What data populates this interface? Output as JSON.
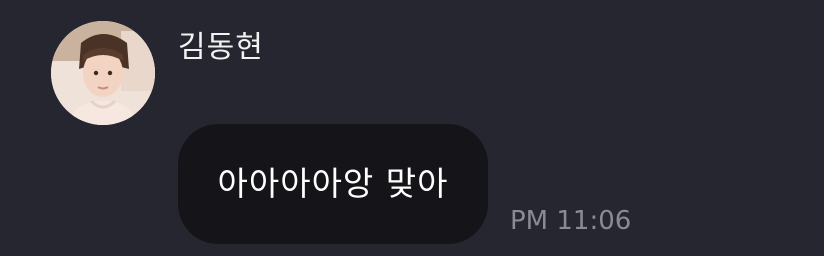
{
  "chat": {
    "sender": {
      "name": "김동현",
      "avatar_icon": "profile-photo"
    },
    "message": {
      "text": "아아아아앙 맞아",
      "time": "PM 11:06"
    }
  },
  "colors": {
    "background": "#262630",
    "bubble": "#141419",
    "text": "#ffffff",
    "timestamp": "#8a8a92"
  }
}
